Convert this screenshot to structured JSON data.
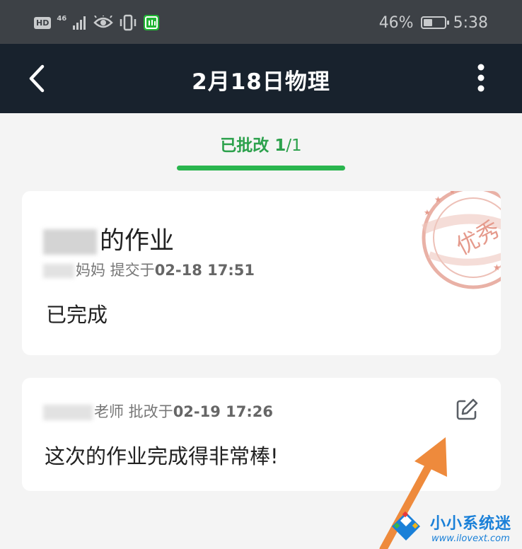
{
  "status_bar": {
    "hd_badge": "HD",
    "network": "46",
    "battery_percent": "46%",
    "battery_level": 0.46,
    "time": "5:38",
    "icons": [
      "hd-icon",
      "signal-icon",
      "eye-icon",
      "vibrate-icon",
      "iqiyi-app-icon",
      "battery-icon"
    ]
  },
  "header": {
    "title": "2月18日物理",
    "back_icon": "chevron-left-icon",
    "more_icon": "more-vertical-icon"
  },
  "tabs": [
    {
      "label": "已批改 ",
      "count": "1",
      "total": "/1",
      "active": true
    }
  ],
  "submission": {
    "title_suffix": "的作业",
    "submitter_suffix": "妈妈",
    "submit_label": " 提交于",
    "submit_time": "02-18 17:51",
    "status": "已完成",
    "stamp_text": "优秀"
  },
  "review": {
    "teacher_suffix": "老师",
    "review_label": " 批改于",
    "review_time": "02-19 17:26",
    "comment": "这次的作业完成得非常棒!",
    "edit_icon": "edit-icon"
  },
  "watermark": {
    "title": "小小系统迷",
    "url": "www.ilovext.com"
  },
  "colors": {
    "accent_green": "#2ab54e",
    "header_bg": "#18222d",
    "status_bar_bg": "#3d4146",
    "stamp_red": "#e59a8c",
    "arrow_orange": "#ee8a3c",
    "watermark_blue": "#1a80d8"
  }
}
